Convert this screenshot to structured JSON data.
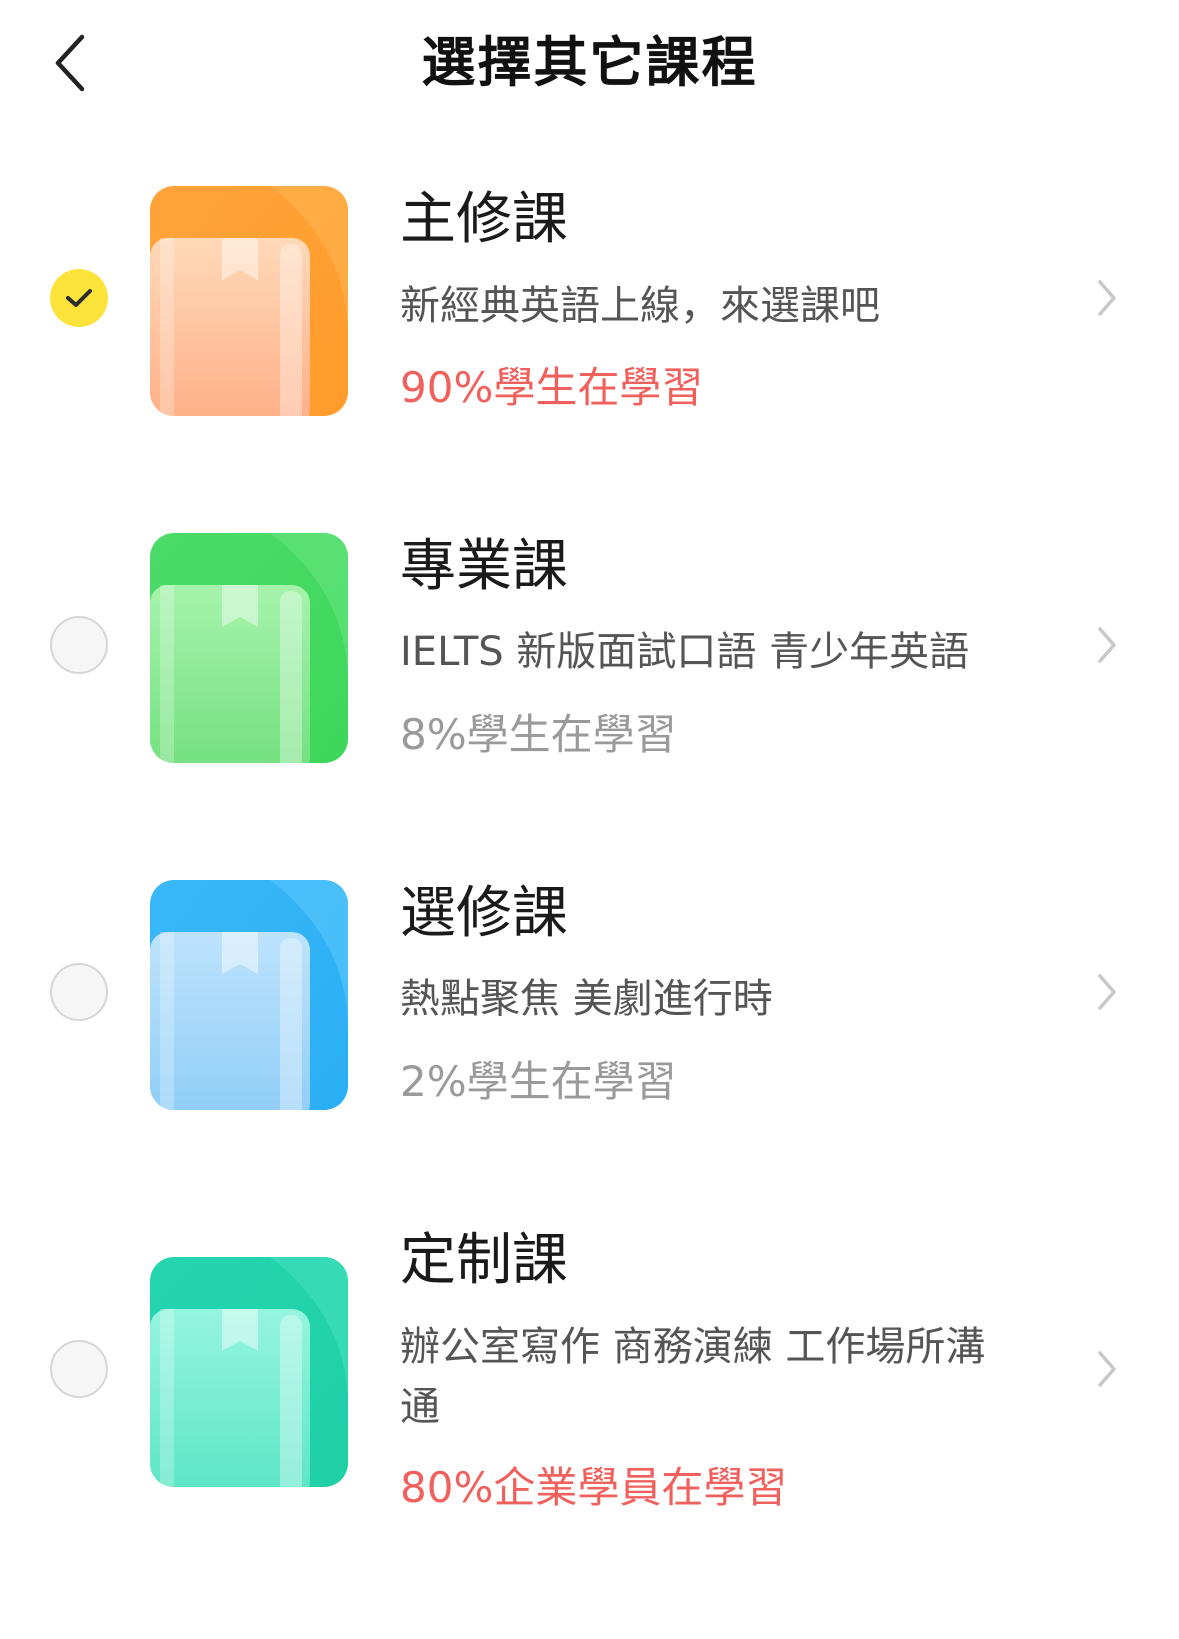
{
  "header": {
    "title": "選擇其它課程",
    "back_icon": "chevron-left-icon"
  },
  "courses": [
    {
      "name": "主修課",
      "description": "新經典英語上線，來選課吧",
      "stat": "90%學生在學習",
      "stat_color": "#f0605c",
      "selected": true,
      "cover_theme": "orange"
    },
    {
      "name": "專業課",
      "description": "IELTS 新版面試口語 青少年英語",
      "stat": "8%學生在學習",
      "stat_color": "#9a9a9a",
      "selected": false,
      "cover_theme": "green"
    },
    {
      "name": "選修課",
      "description": "熱點聚焦 美劇進行時",
      "stat": "2%學生在學習",
      "stat_color": "#9a9a9a",
      "selected": false,
      "cover_theme": "blue"
    },
    {
      "name": "定制課",
      "description": "辦公室寫作 商務演練 工作場所溝通",
      "stat": "80%企業學員在學習",
      "stat_color": "#f0605c",
      "selected": false,
      "cover_theme": "teal"
    }
  ],
  "colors": {
    "selected_radio": "#fbe33a",
    "accent_stat": "#f0605c",
    "muted_stat": "#9a9a9a"
  }
}
